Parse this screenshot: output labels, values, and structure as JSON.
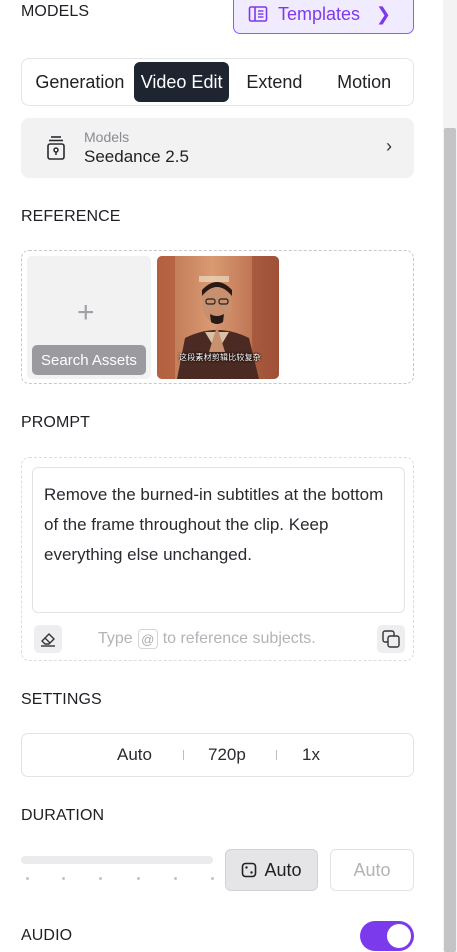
{
  "models_section": {
    "title": "MODELS",
    "templates_label": "Templates"
  },
  "tabs": [
    {
      "label": "Generation",
      "active": false
    },
    {
      "label": "Video Edit",
      "active": true
    },
    {
      "label": "Extend",
      "active": false
    },
    {
      "label": "Motion",
      "active": false
    }
  ],
  "model_selector": {
    "label": "Models",
    "name": "Seedance 2.5"
  },
  "reference": {
    "title": "REFERENCE",
    "search_label": "Search Assets",
    "thumbnail_caption": "这段素材剪辑比较复杂"
  },
  "prompt": {
    "title": "PROMPT",
    "value": "Remove the burned-in subtitles at the bottom of the frame throughout the clip. Keep everything else unchanged.",
    "hint_before": "Type",
    "hint_chip": "@",
    "hint_after": "to reference subjects."
  },
  "settings": {
    "title": "SETTINGS",
    "aspect": "Auto",
    "resolution": "720p",
    "speed": "1x"
  },
  "duration": {
    "title": "DURATION",
    "auto_label": "Auto",
    "input_placeholder": "Auto"
  },
  "audio": {
    "title": "AUDIO",
    "enabled": true
  },
  "colors": {
    "accent": "#7c3aed",
    "active_tab": "#1e2430"
  }
}
